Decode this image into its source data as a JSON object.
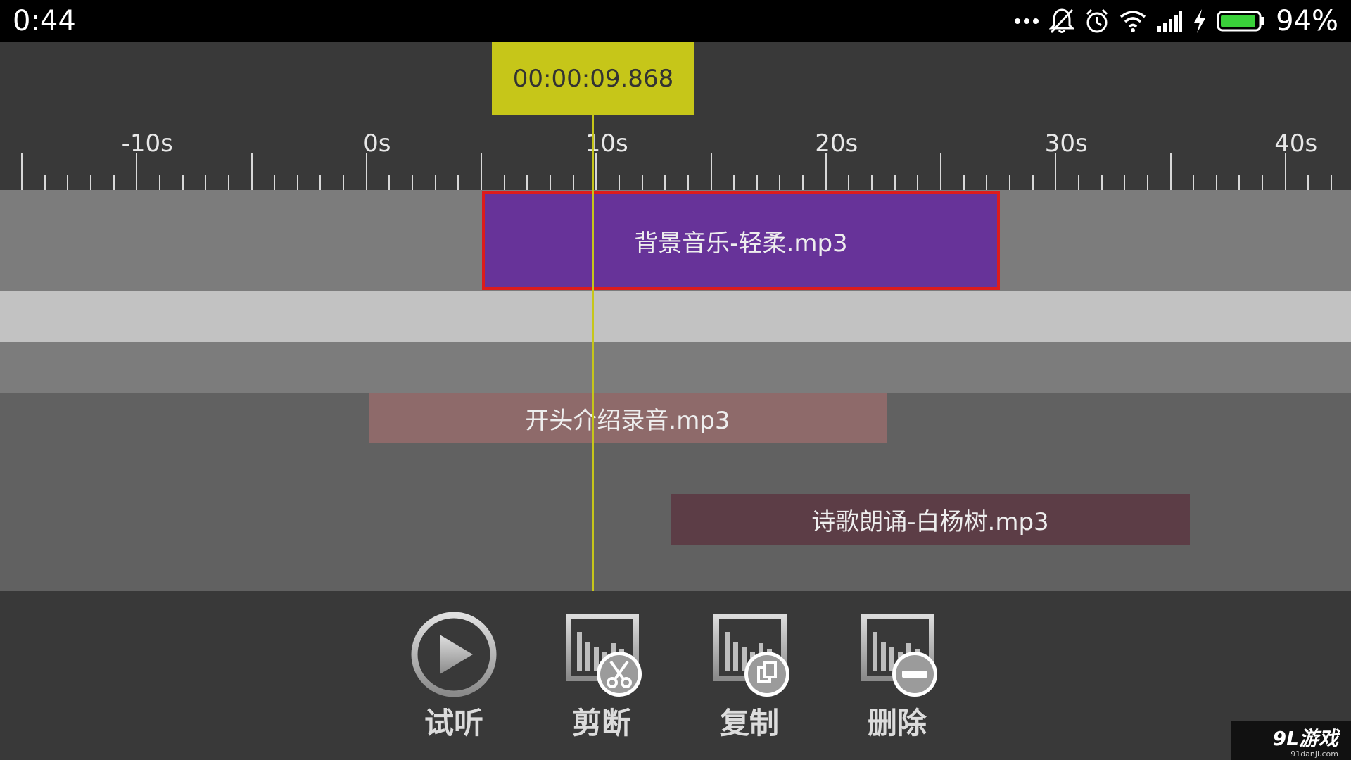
{
  "status_bar": {
    "time": "0:44",
    "more_icon": "more-dots-icon",
    "mute_icon": "notifications-off-icon",
    "alarm_icon": "alarm-icon",
    "wifi_icon": "wifi-icon",
    "signal_icon": "signal-icon",
    "charging_icon": "charging-bolt-icon",
    "battery_level": 0.94,
    "battery_text": "94%"
  },
  "timeline": {
    "current_time": "00:00:09.868",
    "ruler_labels": [
      "-10s",
      "0s",
      "10s",
      "20s",
      "30s",
      "40s"
    ],
    "playhead_color": "#c6c619"
  },
  "tracks": [
    {
      "clip_name": "背景音乐-轻柔.mp3",
      "color": "#673399",
      "selected": true,
      "selection_color": "#dd1c1c"
    },
    {
      "clip_name": "开头介绍录音.mp3",
      "color": "#8e6a6a",
      "selected": false
    },
    {
      "clip_name": "诗歌朗诵-白杨树.mp3",
      "color": "#5c3d46",
      "selected": false
    }
  ],
  "toolbar": {
    "preview": {
      "label": "试听",
      "icon": "play-icon"
    },
    "cut": {
      "label": "剪断",
      "icon": "cut-icon"
    },
    "copy": {
      "label": "复制",
      "icon": "copy-icon"
    },
    "delete": {
      "label": "删除",
      "icon": "delete-icon"
    }
  },
  "watermark": {
    "brand": "9L游戏",
    "site": "91danji.com"
  }
}
